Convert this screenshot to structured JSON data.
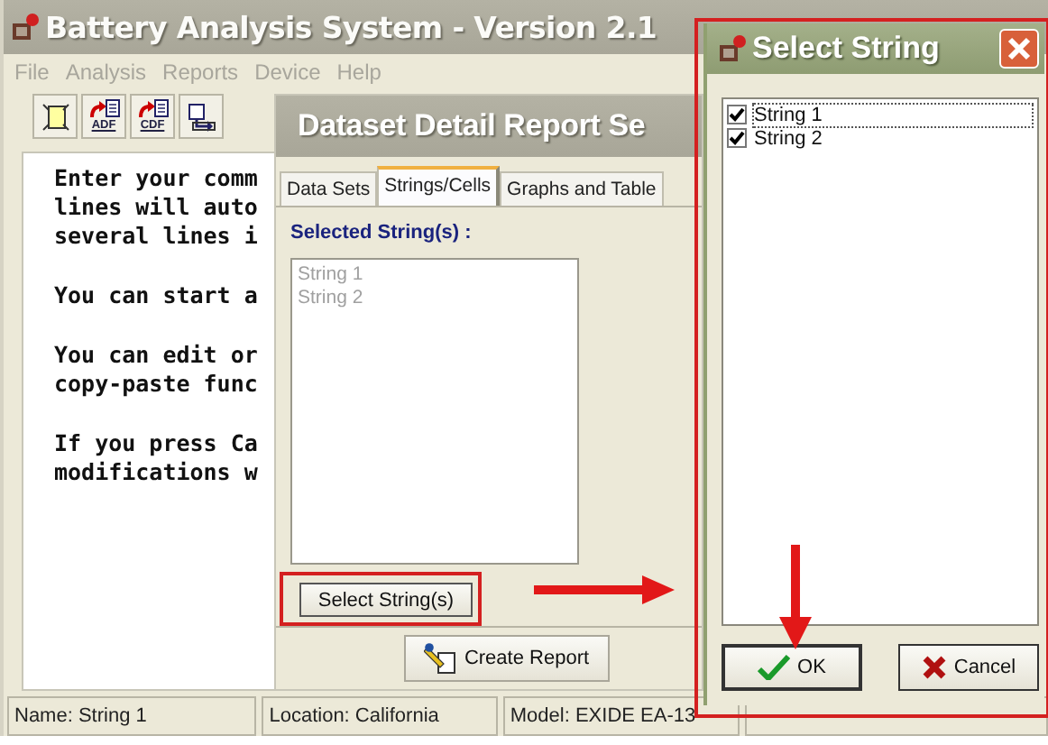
{
  "main_window": {
    "title": "Battery Analysis System - Version 2.1",
    "menu": [
      "File",
      "Analysis",
      "Reports",
      "Device",
      "Help"
    ],
    "toolbar": [
      {
        "kind": "new"
      },
      {
        "kind": "export",
        "label": "ADF"
      },
      {
        "kind": "export",
        "label": "CDF"
      },
      {
        "kind": "import"
      }
    ],
    "comment_paragraphs": [
      [
        "Enter your comm",
        "lines will auto",
        "several lines i"
      ],
      [
        "You can start a"
      ],
      [
        "You can edit or",
        "copy-paste func"
      ],
      [
        "If you press Ca",
        "modifications w"
      ]
    ],
    "status_bar": [
      "Name: String 1",
      "Location: California",
      "Model: EXIDE EA-13"
    ]
  },
  "report_dialog": {
    "title": "Dataset Detail Report Se",
    "tabs": [
      {
        "label": "Data Sets",
        "selected": false
      },
      {
        "label": "Strings/Cells",
        "selected": true
      },
      {
        "label": "Graphs and Table",
        "selected": false
      }
    ],
    "section_label": "Selected String(s) :",
    "strings": [
      "String 1",
      "String 2"
    ],
    "select_button": "Select String(s)",
    "create_button": "Create Report"
  },
  "select_dialog": {
    "title": "Select String",
    "items": [
      {
        "label": "String 1",
        "checked": true,
        "focused": true
      },
      {
        "label": "String 2",
        "checked": true,
        "focused": false
      }
    ],
    "ok_button": "OK",
    "cancel_button": "Cancel"
  }
}
